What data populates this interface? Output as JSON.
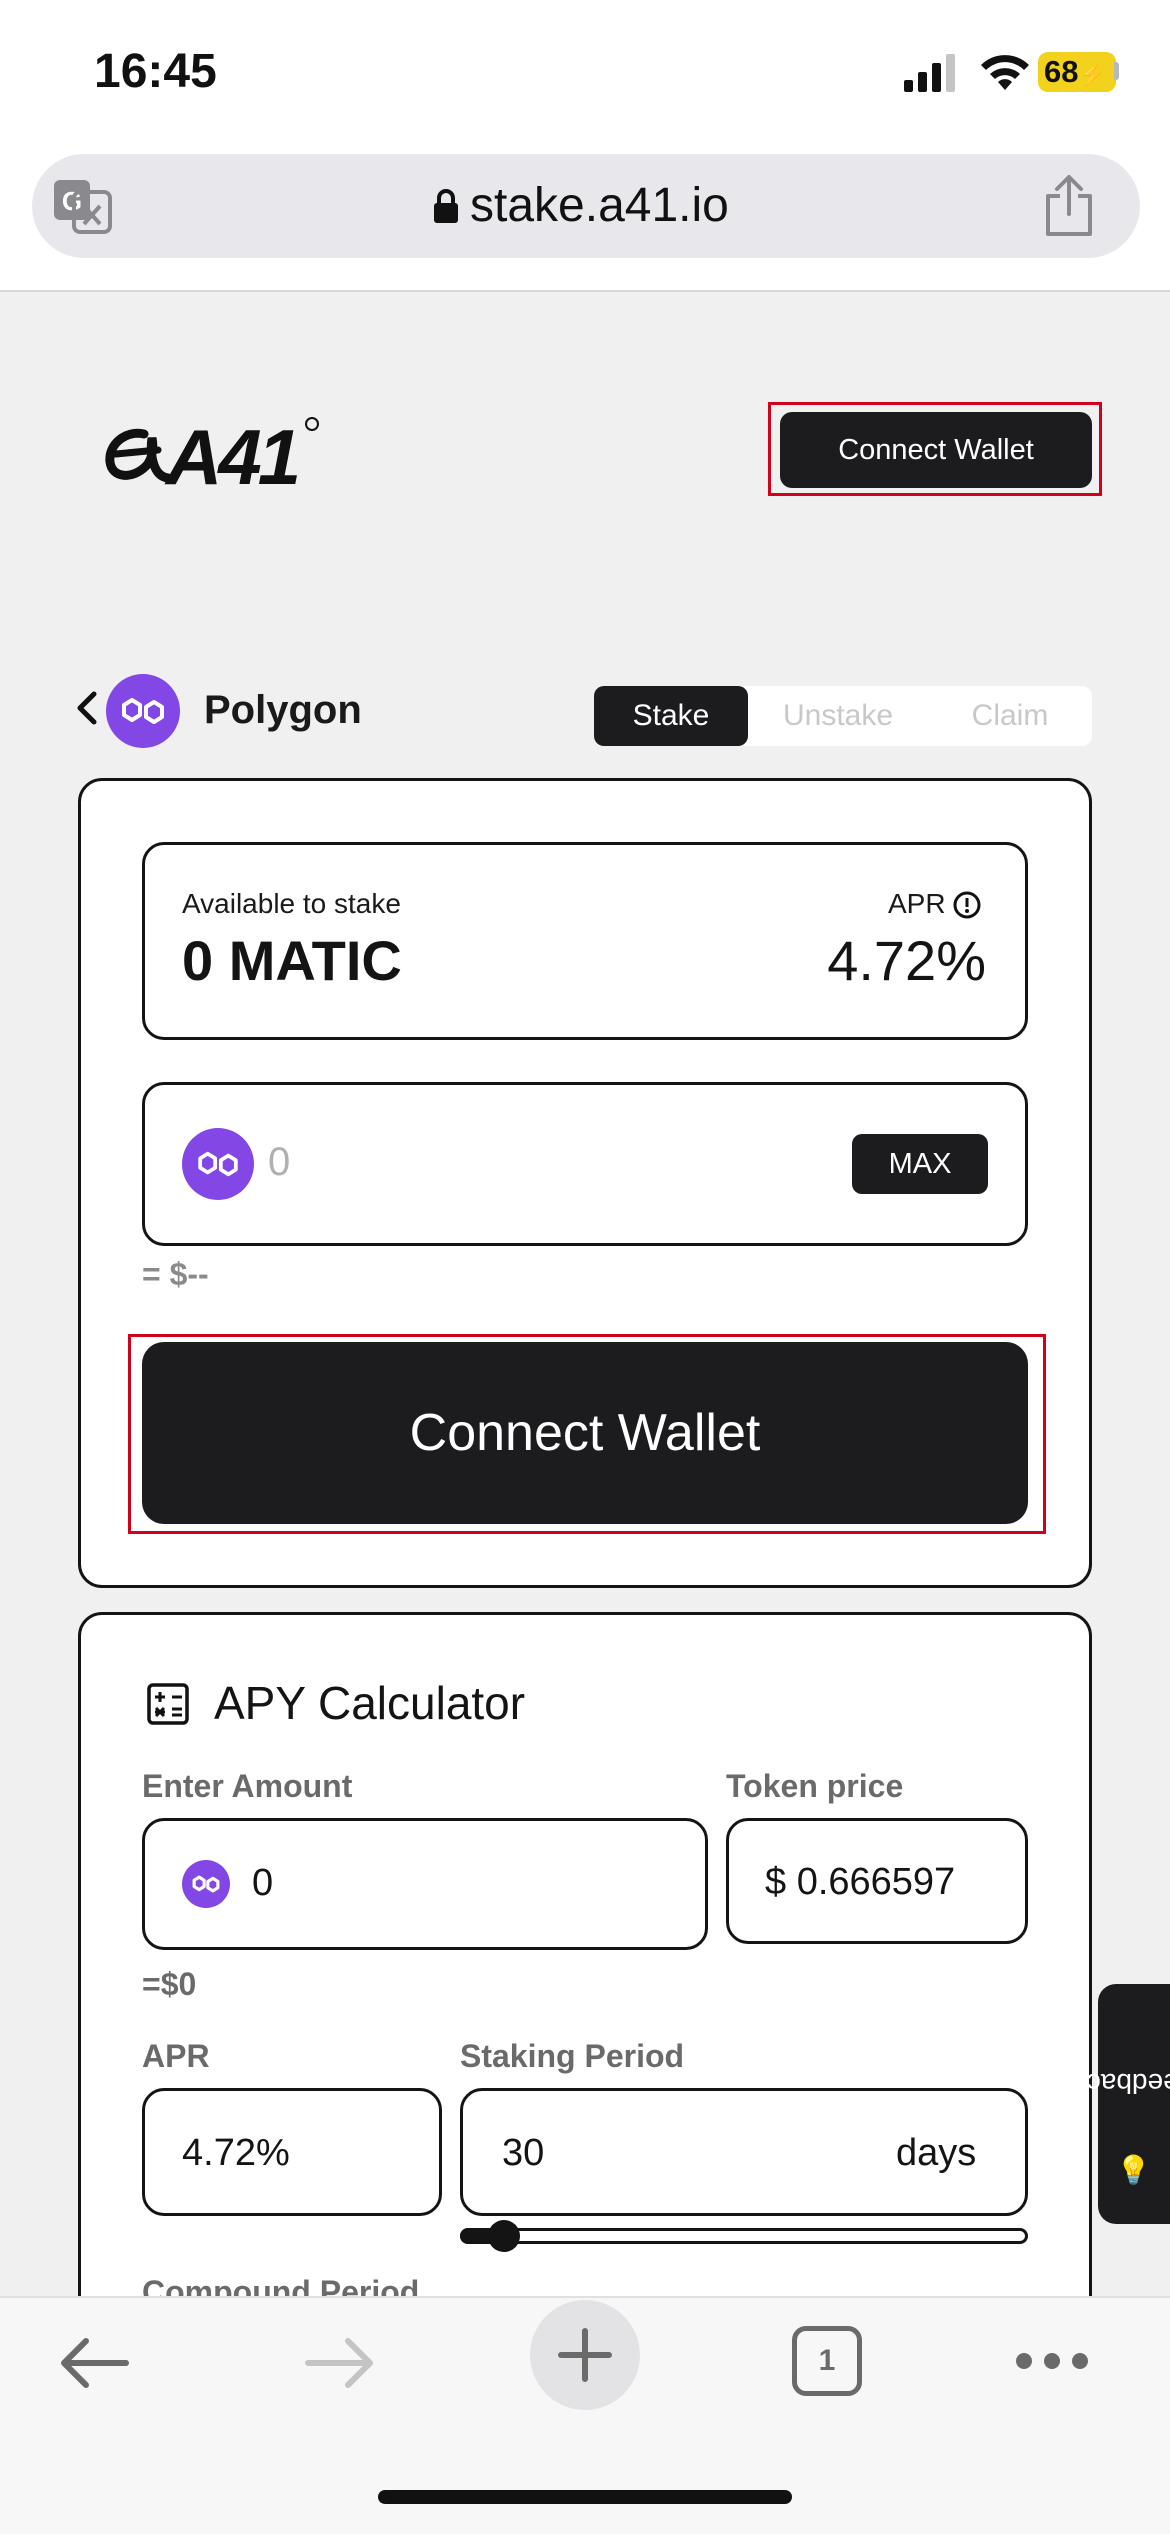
{
  "status_bar": {
    "time": "16:45",
    "battery": "68"
  },
  "browser": {
    "url": "stake.a41.io"
  },
  "header": {
    "logo": "A41",
    "connect_label": "Connect Wallet"
  },
  "network": {
    "name": "Polygon"
  },
  "tabs": [
    {
      "label": "Stake",
      "active": true
    },
    {
      "label": "Unstake",
      "active": false
    },
    {
      "label": "Claim",
      "active": false
    }
  ],
  "stake_card": {
    "available_label": "Available to stake",
    "available_value": "0 MATIC",
    "apr_label": "APR",
    "apr_value": "4.72%",
    "amount_placeholder": "0",
    "max_label": "MAX",
    "usd_estimate": "= $--",
    "connect_label": "Connect Wallet"
  },
  "calculator": {
    "title": "APY Calculator",
    "enter_amount_label": "Enter Amount",
    "amount_value": "0",
    "usd_value": "=$0",
    "token_price_label": "Token price",
    "token_price_value": "$ 0.666597",
    "apr_label": "APR",
    "apr_value": "4.72%",
    "staking_period_label": "Staking Period",
    "staking_period_value": "30",
    "staking_period_unit": "days",
    "compound_label": "Compound Period"
  },
  "feedback_label": "Feedback",
  "toolbar": {
    "tabs_count": "1"
  },
  "colors": {
    "polygon": "#8247e5",
    "dark": "#1c1c1e",
    "highlight": "#d0021b",
    "battery": "#f2d21d"
  }
}
